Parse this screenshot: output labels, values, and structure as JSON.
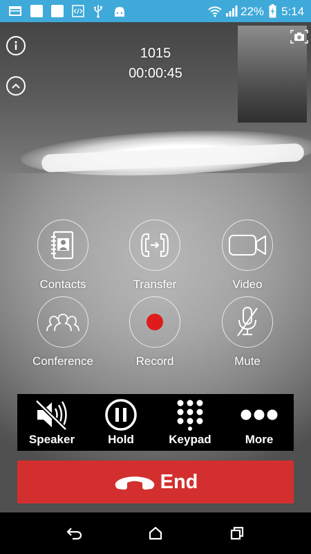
{
  "status_bar": {
    "battery_percent": "22%",
    "time": "5:14",
    "left_icons": [
      "screen-icon",
      "square-icon",
      "square-icon",
      "code-icon",
      "usb-icon",
      "android-icon"
    ],
    "right_icons": [
      "wifi-icon",
      "signal-icon",
      "battery-charging-icon"
    ]
  },
  "call": {
    "number": "1015",
    "duration": "00:00:45"
  },
  "actions": [
    {
      "label": "Contacts",
      "icon": "contacts-book-icon"
    },
    {
      "label": "Transfer",
      "icon": "phone-transfer-icon"
    },
    {
      "label": "Video",
      "icon": "video-camera-icon"
    },
    {
      "label": "Conference",
      "icon": "people-icon"
    },
    {
      "label": "Record",
      "icon": "record-dot-icon"
    },
    {
      "label": "Mute",
      "icon": "mic-off-icon"
    }
  ],
  "controls": [
    {
      "label": "Speaker",
      "icon": "speaker-off-icon"
    },
    {
      "label": "Hold",
      "icon": "pause-icon"
    },
    {
      "label": "Keypad",
      "icon": "dialpad-icon"
    },
    {
      "label": "More",
      "icon": "more-dots-icon"
    }
  ],
  "end_button": {
    "label": "End",
    "icon": "hangup-icon"
  },
  "colors": {
    "status_bar": "#3fa9d9",
    "end_button": "#d32f2f",
    "record_dot": "#e01b1b",
    "control_bar": "#000000"
  },
  "nav_icons": [
    "back-icon",
    "home-icon",
    "recents-icon"
  ]
}
